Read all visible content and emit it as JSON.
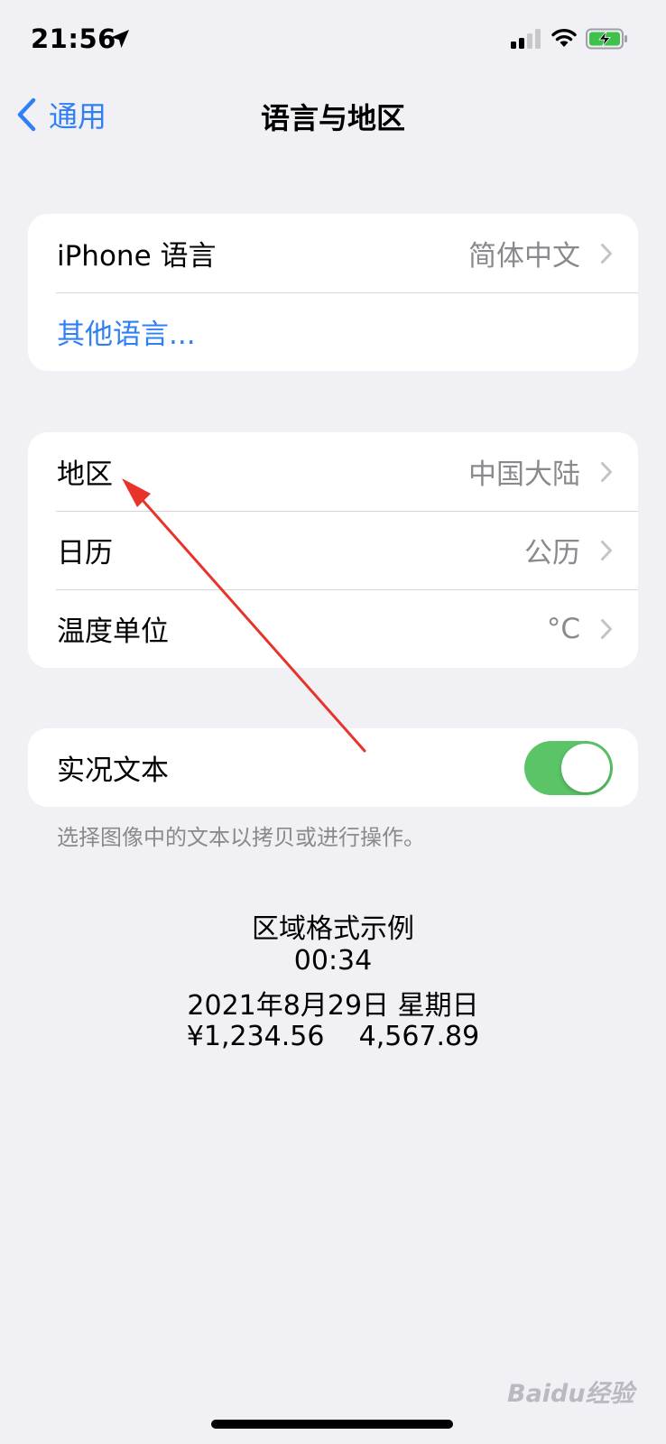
{
  "status_bar": {
    "time": "21:56"
  },
  "nav": {
    "back_label": "通用",
    "title": "语言与地区"
  },
  "language_card": {
    "iphone_language_label": "iPhone 语言",
    "iphone_language_value": "简体中文",
    "other_languages_label": "其他语言..."
  },
  "region_card": {
    "region_label": "地区",
    "region_value": "中国大陆",
    "calendar_label": "日历",
    "calendar_value": "公历",
    "temperature_label": "温度单位",
    "temperature_value": "°C"
  },
  "live_text": {
    "label": "实况文本",
    "enabled": true,
    "footnote": "选择图像中的文本以拷贝或进行操作。"
  },
  "region_format": {
    "heading": "区域格式示例",
    "time": "00:34",
    "date": "2021年8月29日 星期日",
    "numbers": "¥1,234.56    4,567.89"
  },
  "watermark": "Baidu经验",
  "colors": {
    "accent": "#2f7ff5",
    "toggle_on": "#5ac466",
    "background": "#f0f0f5",
    "annotation_arrow": "#e8332b"
  }
}
